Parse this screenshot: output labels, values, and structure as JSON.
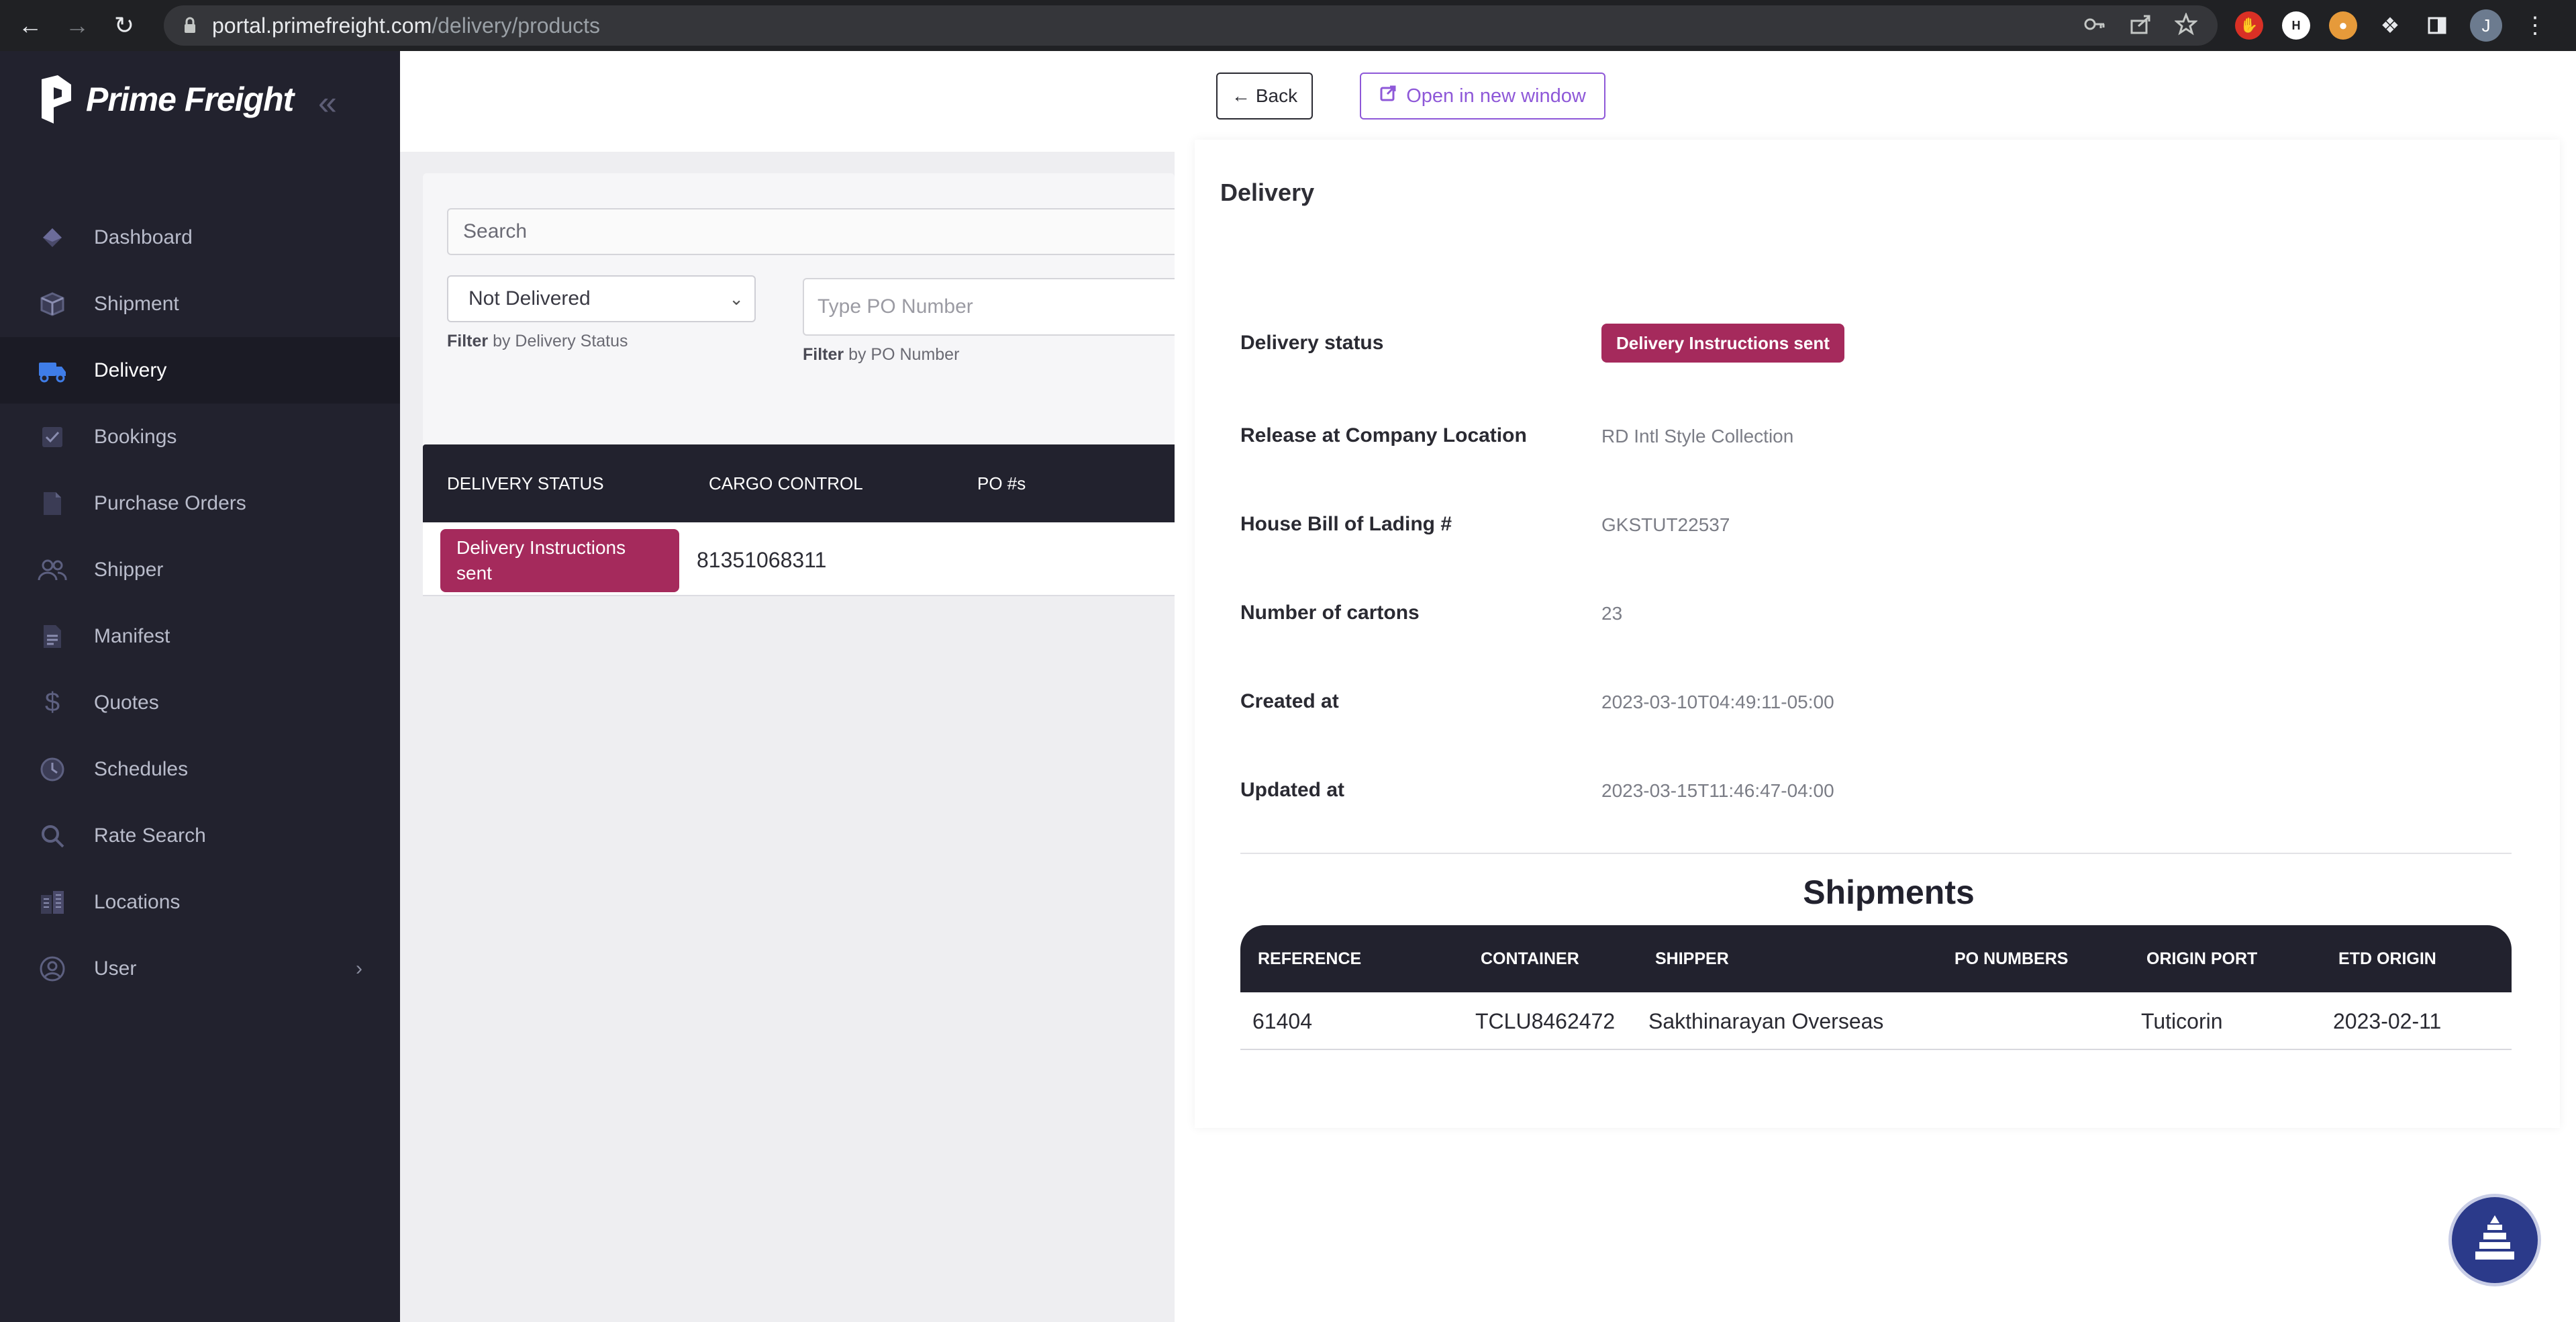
{
  "browser": {
    "url_host": "portal.primefreight.com",
    "url_path": "/delivery/products",
    "profile_initial": "J"
  },
  "sidebar": {
    "brand": "Prime Freight",
    "items": [
      {
        "label": "Dashboard",
        "icon": "diamond-icon"
      },
      {
        "label": "Shipment",
        "icon": "box-icon"
      },
      {
        "label": "Delivery",
        "icon": "truck-icon",
        "active": true
      },
      {
        "label": "Bookings",
        "icon": "checkbox-icon"
      },
      {
        "label": "Purchase Orders",
        "icon": "document-icon"
      },
      {
        "label": "Shipper",
        "icon": "users-icon"
      },
      {
        "label": "Manifest",
        "icon": "file-text-icon"
      },
      {
        "label": "Quotes",
        "icon": "dollar-icon"
      },
      {
        "label": "Schedules",
        "icon": "clock-icon"
      },
      {
        "label": "Rate Search",
        "icon": "search-icon"
      },
      {
        "label": "Locations",
        "icon": "buildings-icon"
      },
      {
        "label": "User",
        "icon": "user-circle-icon"
      }
    ]
  },
  "filters": {
    "search_placeholder": "Search",
    "status_value": "Not Delivered",
    "status_hint_bold": "Filter",
    "status_hint_rest": " by Delivery Status",
    "po_placeholder": "Type PO Number",
    "po_hint_bold": "Filter",
    "po_hint_rest": " by PO Number"
  },
  "list_table": {
    "headers": [
      "DELIVERY STATUS",
      "CARGO CONTROL",
      "PO #s"
    ],
    "rows": [
      {
        "status": "Delivery Instructions sent",
        "cargo_control": "81351068311",
        "po": ""
      }
    ]
  },
  "drawer": {
    "back_label": "Back",
    "open_label": "Open in new window",
    "title": "Delivery",
    "fields": [
      {
        "label": "Delivery status",
        "value": "Delivery Instructions sent"
      },
      {
        "label": "Release at Company Location",
        "value": "RD Intl Style Collection"
      },
      {
        "label": "House Bill of Lading #",
        "value": "GKSTUT22537"
      },
      {
        "label": "Number of cartons",
        "value": "23"
      },
      {
        "label": "Created at",
        "value": "2023-03-10T04:49:11-05:00"
      },
      {
        "label": "Updated at",
        "value": "2023-03-15T11:46:47-04:00"
      }
    ],
    "shipments_title": "Shipments",
    "shipments_headers": [
      "REFERENCE",
      "CONTAINER",
      "SHIPPER",
      "PO NUMBERS",
      "ORIGIN PORT",
      "ETD ORIGIN"
    ],
    "shipments_rows": [
      {
        "reference": "61404",
        "container": "TCLU8462472",
        "shipper": "Sakthinarayan Overseas",
        "po_numbers": "",
        "origin_port": "Tuticorin",
        "etd_origin": "2023-02-11"
      }
    ]
  },
  "colors": {
    "sidebar_bg": "#22222e",
    "badge": "#a52a5c",
    "accent_purple": "#8e58d8"
  }
}
